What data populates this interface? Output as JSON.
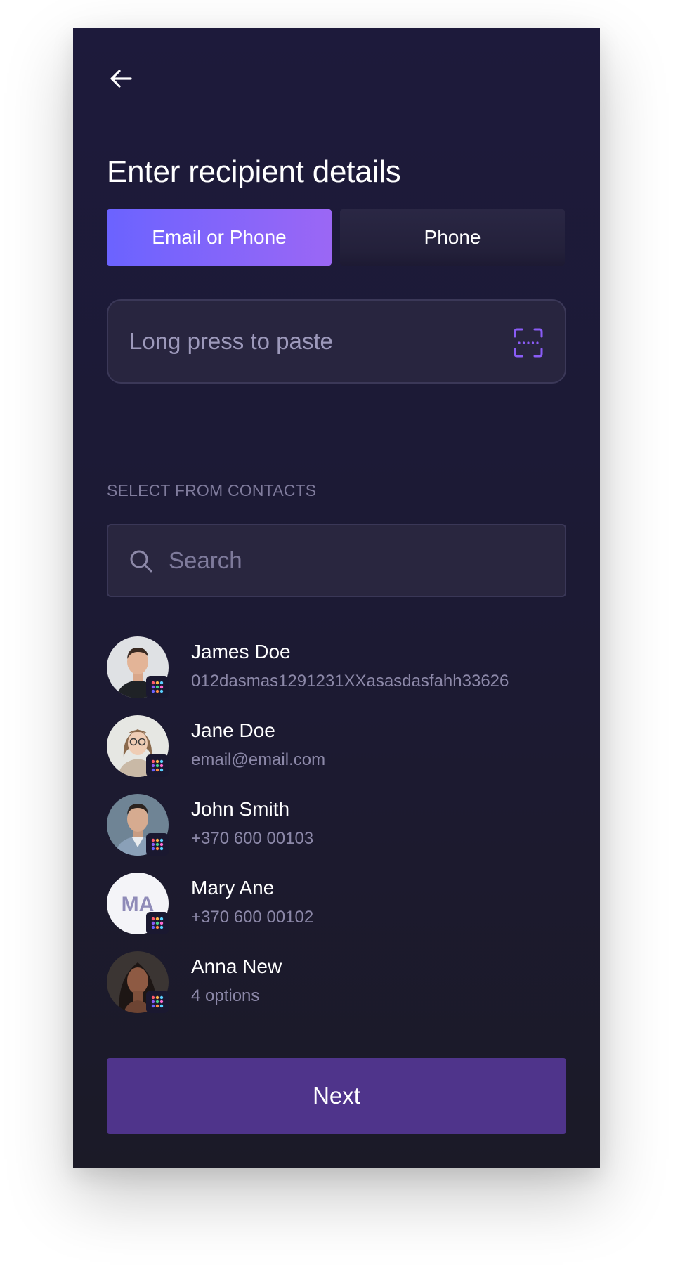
{
  "header": {
    "back_icon": "arrow-left-icon",
    "title": "Enter recipient details"
  },
  "tabs": [
    {
      "label": "Email or Phone",
      "active": true
    },
    {
      "label": "Phone",
      "active": false
    }
  ],
  "paste_field": {
    "placeholder": "Long press to paste",
    "value": "",
    "icon": "scan-qr-icon"
  },
  "contacts_section": {
    "label": "SELECT FROM CONTACTS",
    "search": {
      "placeholder": "Search",
      "value": "",
      "icon": "search-icon"
    },
    "items": [
      {
        "name": "James Doe",
        "detail": "012dasmas1291231XXasasdasfahh33626",
        "avatar": "photo"
      },
      {
        "name": "Jane Doe",
        "detail": "email@email.com",
        "avatar": "photo"
      },
      {
        "name": "John Smith",
        "detail": "+370 600 00103",
        "avatar": "photo"
      },
      {
        "name": "Mary Ane",
        "detail": "+370 600 00102",
        "avatar": "initials",
        "initials": "MA"
      },
      {
        "name": "Anna New",
        "detail": "4 options",
        "avatar": "photo"
      }
    ]
  },
  "footer": {
    "next_label": "Next"
  },
  "colors": {
    "background": "#1c1a33",
    "accent_start": "#6b63ff",
    "accent_end": "#9b67f5",
    "next_button": "#4f348b",
    "muted_text": "#8c88a8"
  }
}
